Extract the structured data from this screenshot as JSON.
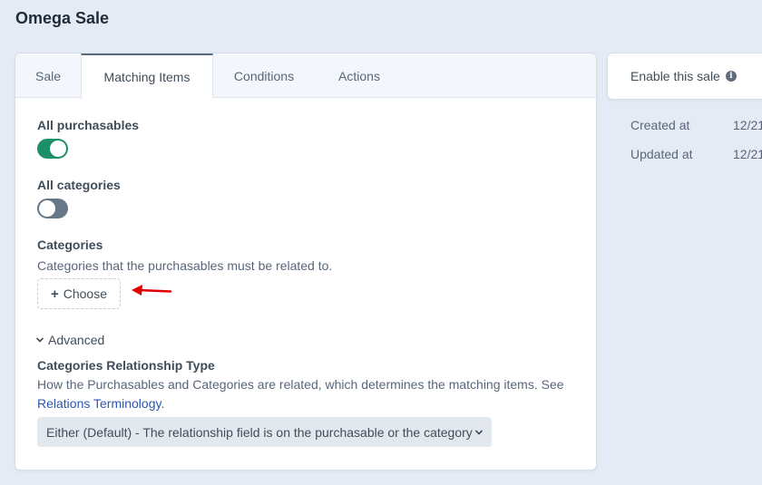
{
  "page": {
    "title": "Omega Sale"
  },
  "tabs": [
    {
      "label": "Sale"
    },
    {
      "label": "Matching Items"
    },
    {
      "label": "Conditions"
    },
    {
      "label": "Actions"
    }
  ],
  "fields": {
    "all_purchasables": {
      "label": "All purchasables",
      "enabled": true
    },
    "all_categories": {
      "label": "All categories",
      "enabled": false
    },
    "categories": {
      "label": "Categories",
      "instructions": "Categories that the purchasables must be related to.",
      "choose_label": "Choose"
    }
  },
  "advanced": {
    "toggle_label": "Advanced",
    "relationship": {
      "label": "Categories Relationship Type",
      "instructions": "How the Purchasables and Categories are related, which determines the matching items. See",
      "link_text": "Relations Terminology",
      "link_suffix": ".",
      "selected": "Either (Default) - The relationship field is on the purchasable or the category"
    }
  },
  "sidebar": {
    "enable_label": "Enable this sale",
    "meta": [
      {
        "label": "Created at",
        "value": "12/21"
      },
      {
        "label": "Updated at",
        "value": "12/21"
      }
    ]
  },
  "colors": {
    "toggle_on": "#1b8f6a",
    "toggle_off": "#67778a",
    "link": "#2d57b3",
    "annotation_arrow": "#e00000"
  },
  "icons": [
    "info-icon",
    "plus-icon",
    "chevron-down-icon",
    "annotation-arrow-icon"
  ]
}
